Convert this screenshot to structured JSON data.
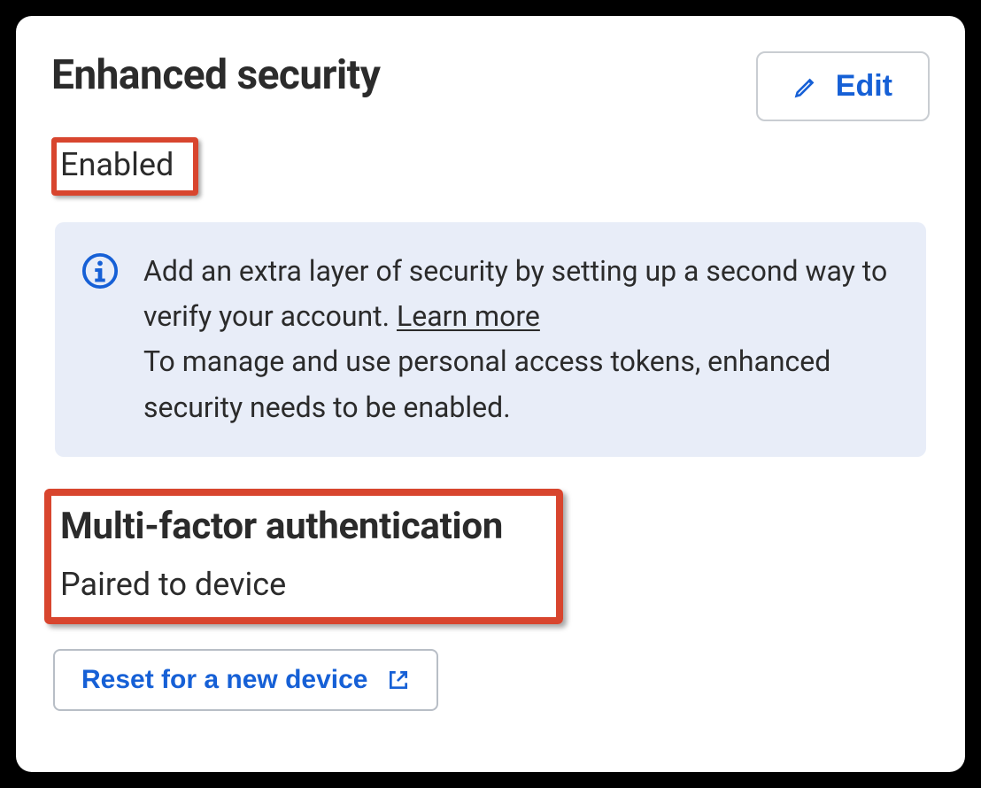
{
  "header": {
    "title": "Enhanced security",
    "edit_label": "Edit"
  },
  "status": {
    "enabled_label": "Enabled"
  },
  "info": {
    "text_part1": "Add an extra layer of security by setting up a second way to verify your account. ",
    "learn_more": "Learn more",
    "text_part2": "To manage and use personal access tokens, enhanced security needs to be enabled."
  },
  "mfa": {
    "title": "Multi-factor authentication",
    "status": "Paired to device",
    "reset_label": "Reset for a new device"
  }
}
